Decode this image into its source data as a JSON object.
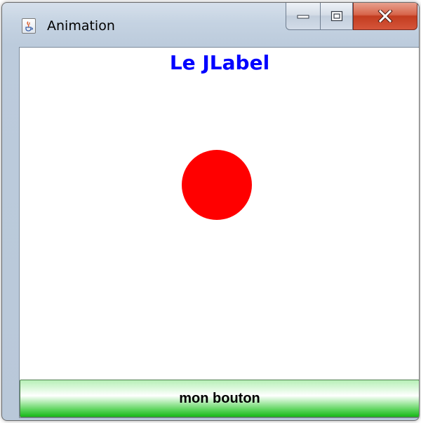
{
  "window": {
    "title": "Animation",
    "icon": "java-cup-icon",
    "controls": [
      "minimize-icon",
      "maximize-icon",
      "close-icon"
    ]
  },
  "content": {
    "label_text": "Le JLabel",
    "label_color": "#0000ff",
    "ball_color": "#ff0000",
    "button_label": "mon bouton",
    "button_color": "#22bb22"
  }
}
